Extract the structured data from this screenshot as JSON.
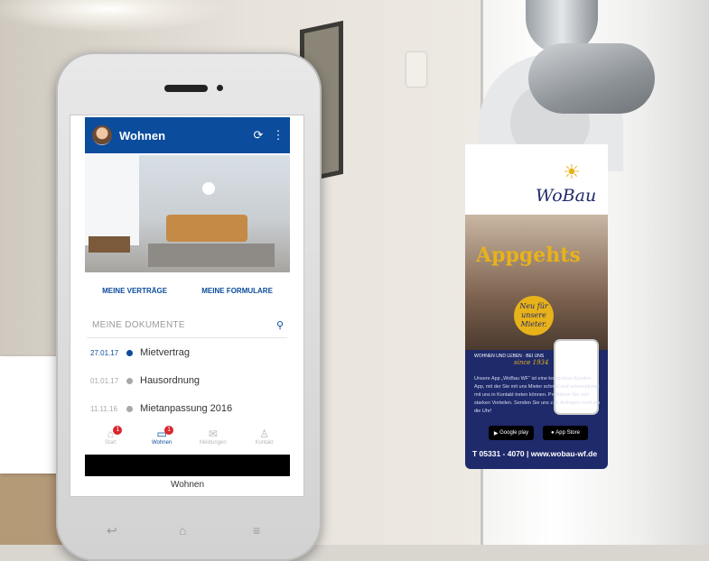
{
  "app": {
    "title": "Wohnen",
    "refresh_icon": "refresh-icon",
    "menu_icon": "more-vert-icon",
    "accent": "#0b4c9c",
    "tabs": [
      {
        "label": "MEINE VERTRÄGE"
      },
      {
        "label": "MEINE FORMULARE"
      }
    ],
    "search": {
      "placeholder": "MEINE DOKUMENTE",
      "icon": "search-icon"
    },
    "documents": [
      {
        "date": "27.01.17",
        "title": "Mietvertrag",
        "status_color": "#0b4c9c"
      },
      {
        "date": "01.01.17",
        "title": "Hausordnung",
        "status_color": "#a8a8a8"
      },
      {
        "date": "11.11.16",
        "title": "Mietanpassung 2016",
        "status_color": "#a8a8a8"
      }
    ],
    "bottom_nav": [
      {
        "label": "Start",
        "badge": "1"
      },
      {
        "label": "Wohnen",
        "badge": "1"
      },
      {
        "label": "Meldungen",
        "badge": ""
      },
      {
        "label": "Kontakt",
        "badge": ""
      }
    ],
    "caption": "Wohnen"
  },
  "hanger": {
    "brand": "WoBau",
    "slogan": "Appgehts",
    "stamp_lines": [
      "Neu für",
      "unsere",
      "Mieter."
    ],
    "since_label": "WOHNEN UND LEBEN · BEI UNS",
    "since": "since 1934",
    "blurb": "Unsere App „WoBau WF“ ist eine kostenlose Kunden-App, mit der Sie mit uns Mieter schnell und unkompliziert mit uns in Kontakt treten können. Profitieren Sie von starken Vorteilen. Senden Sie uns z.B. Anfragen rund um die Uhr!",
    "google_play": "Google play",
    "app_store": "App Store",
    "footer": "T 05331 - 4070 | www.wobau-wf.de"
  }
}
